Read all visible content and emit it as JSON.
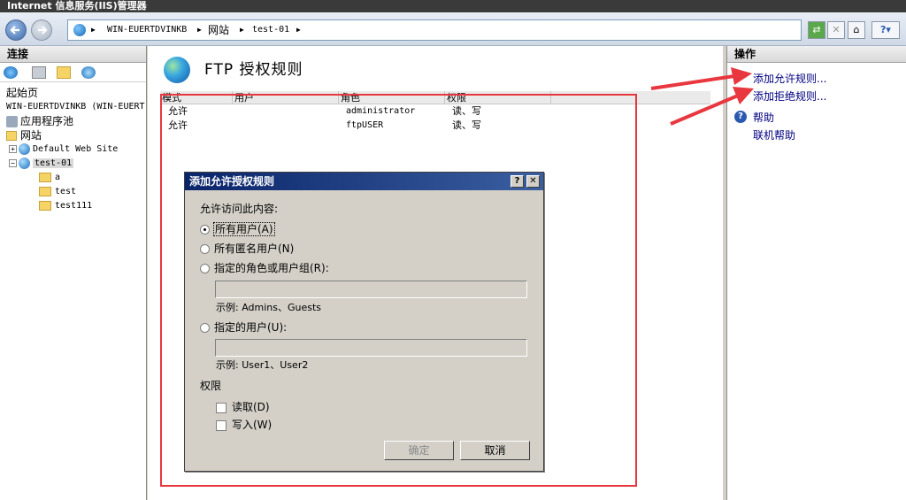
{
  "window": {
    "title": "Internet 信息服务(IIS)管理器"
  },
  "address": {
    "crumbs": [
      "WIN-EUERTDVINKB",
      "网站",
      "test-01"
    ]
  },
  "left_panel": {
    "header": "连接",
    "tree": {
      "start_page": "起始页",
      "server": "WIN-EUERTDVINKB (WIN-EUERT",
      "app_pools": "应用程序池",
      "sites": "网站",
      "default_site": "Default Web Site",
      "test01": "test-01",
      "folders": [
        "a",
        "test",
        "test111"
      ]
    }
  },
  "main": {
    "title": "FTP 授权规则",
    "columns": [
      "模式",
      "用户",
      "角色",
      "权限"
    ],
    "rows": [
      {
        "mode": "允许",
        "user": "",
        "role": "administrator",
        "perm": "读、写"
      },
      {
        "mode": "允许",
        "user": "",
        "role": "ftpUSER",
        "perm": "读、写"
      }
    ]
  },
  "dialog": {
    "title": "添加允许授权规则",
    "help_btn": "?",
    "close_btn": "✕",
    "prompt": "允许访问此内容:",
    "opt_all": "所有用户(A)",
    "opt_anon": "所有匿名用户(N)",
    "opt_roles": "指定的角色或用户组(R):",
    "roles_value": "",
    "roles_example": "示例: Admins、Guests",
    "opt_users": "指定的用户(U):",
    "users_value": "",
    "users_example": "示例: User1、User2",
    "perm_label": "权限",
    "read": "读取(D)",
    "write": "写入(W)",
    "ok": "确定",
    "cancel": "取消",
    "selected_option": "all"
  },
  "right_panel": {
    "header": "操作",
    "add_allow": "添加允许规则...",
    "add_deny": "添加拒绝规则...",
    "help": "帮助",
    "online_help": "联机帮助"
  },
  "colors": {
    "annotation": "#e8373e",
    "title_bar": "#0a246a"
  }
}
